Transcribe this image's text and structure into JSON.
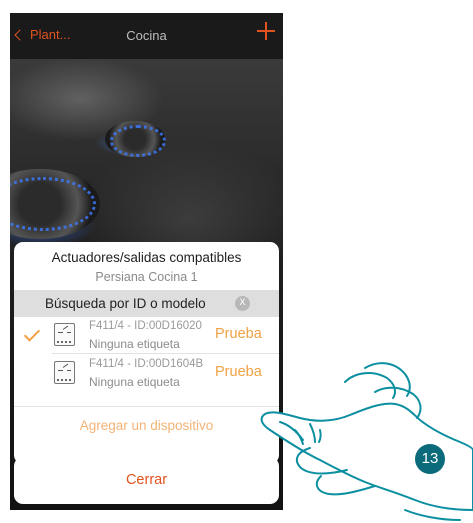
{
  "navbar": {
    "back_label": "Plant...",
    "title": "Cocina",
    "add_icon": "plus-icon"
  },
  "modal": {
    "title": "Actuadores/salidas compatibles",
    "subtitle": "Persiana Cocina 1",
    "search": {
      "label": "Búsqueda por ID o modelo",
      "clear_icon": "x-icon",
      "clear_label": "X"
    },
    "devices": [
      {
        "id": "F411/4 - ID:00D16020",
        "label": "Ninguna etiqueta",
        "action": "Prueba",
        "selected": true
      },
      {
        "id": "F411/4 - ID:00D1604B",
        "label": "Ninguna etiqueta",
        "action": "Prueba",
        "selected": false
      }
    ],
    "add_device_label": "Agregar un dispositivo"
  },
  "close_label": "Cerrar",
  "step_number": "13",
  "colors": {
    "accent": "#e1531f",
    "accent_light": "#f0a143",
    "step_badge": "#0c6b7a"
  }
}
